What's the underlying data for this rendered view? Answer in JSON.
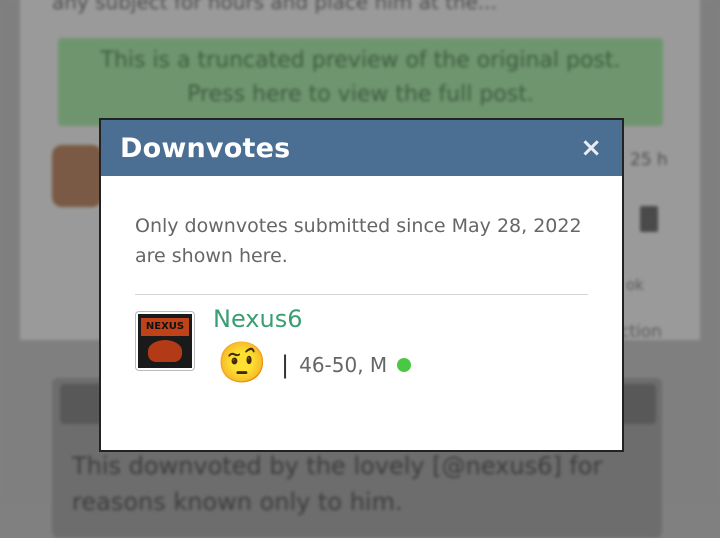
{
  "background": {
    "top_text": "any subject for hours and place him at the...",
    "preview_line1": "This is a truncated preview of the original post.",
    "preview_line2": "Press here to view the full post.",
    "right_text_1": "25 h",
    "right_text_2": "ok",
    "right_text_3": "ction",
    "quote_text_line1": "This downvoted by the lovely [@nexus6] for",
    "quote_text_line2": "reasons known only to him."
  },
  "modal": {
    "title": "Downvotes",
    "close_icon": "×",
    "notice": "Only downvotes submitted since May 28, 2022 are shown here.",
    "users": [
      {
        "avatar_logo": "NEXUS 6",
        "username": "Nexus6",
        "emoji": "🤨",
        "emoji_name": "thumbs-down-face",
        "age_gender": "46-50, M",
        "online": true
      }
    ]
  },
  "colors": {
    "header": "#4b6f93",
    "username": "#3a9e75",
    "online": "#49c843"
  }
}
